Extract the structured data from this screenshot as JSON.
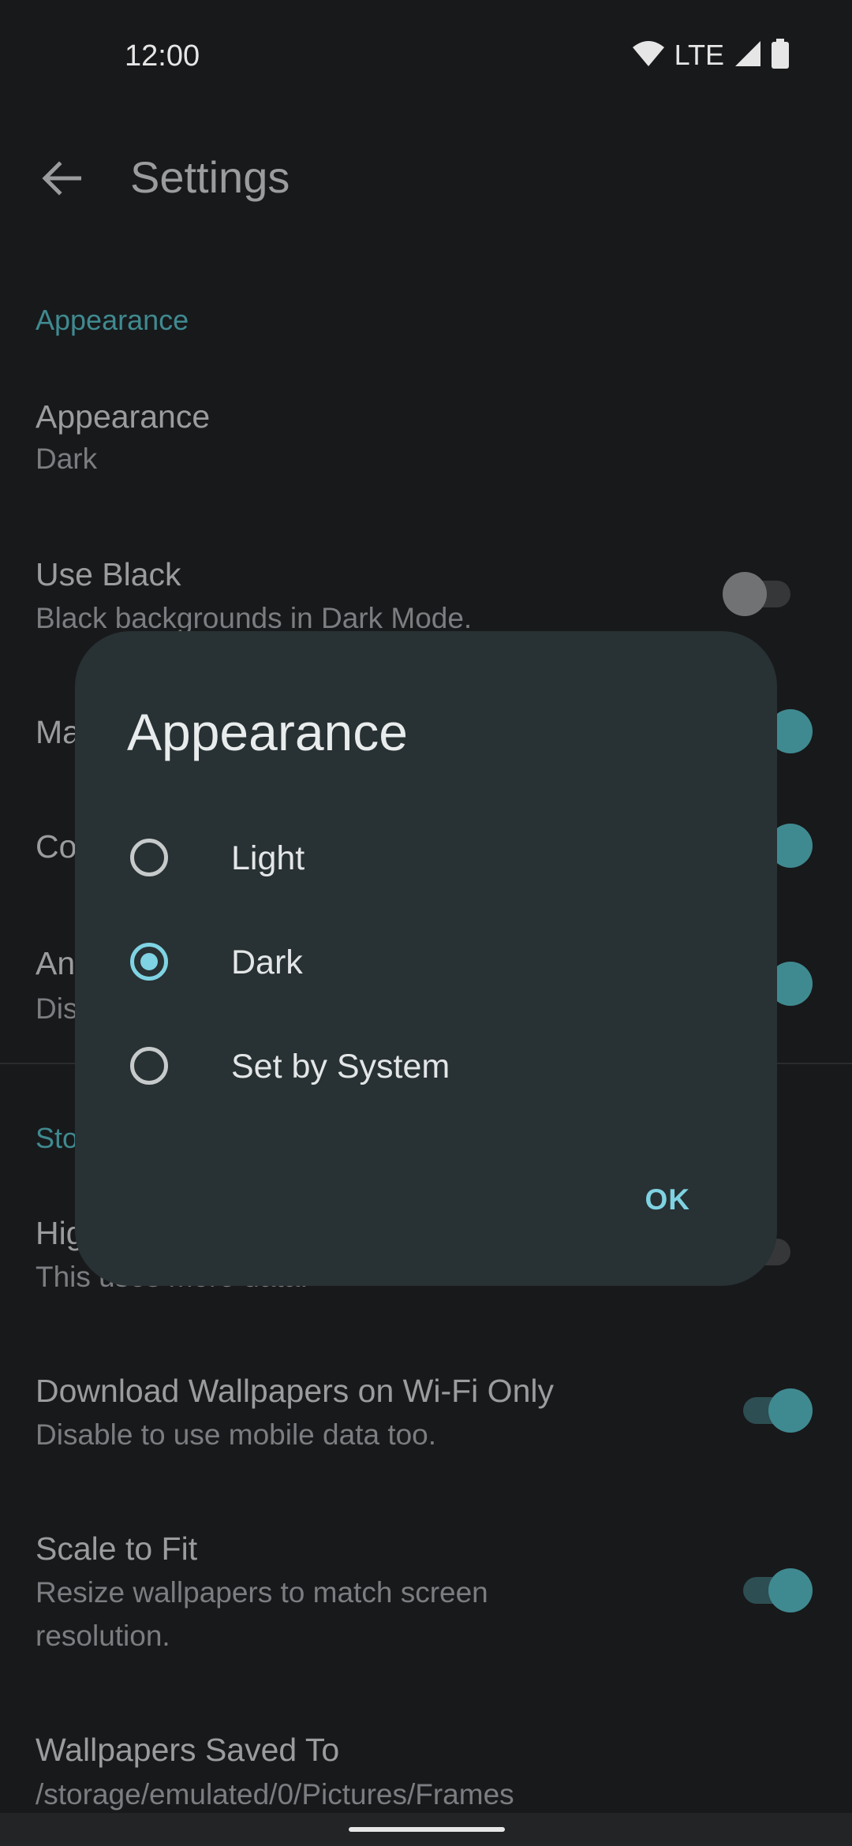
{
  "status_bar": {
    "time": "12:00",
    "network": "LTE",
    "icons": [
      "wifi-icon",
      "signal-icon",
      "battery-icon"
    ]
  },
  "app_bar": {
    "title": "Settings",
    "back_icon": "arrow-back-icon"
  },
  "sections": {
    "appearance_header": "Appearance",
    "storage_header": "Sto"
  },
  "prefs": {
    "appearance": {
      "title": "Appearance",
      "summary": "Dark"
    },
    "use_black": {
      "title": "Use Black",
      "summary": "Black backgrounds in Dark Mode.",
      "enabled": false
    },
    "row3": {
      "title": "Ma",
      "enabled": true
    },
    "row4": {
      "title": "Co",
      "enabled": true
    },
    "row5": {
      "title": "An",
      "summary": "Dis",
      "enabled": true
    },
    "high_quality": {
      "title": "Hig",
      "summary": "This uses more data.",
      "enabled": false
    },
    "wifi_only": {
      "title": "Download Wallpapers on Wi-Fi Only",
      "summary": "Disable to use mobile data too.",
      "enabled": true
    },
    "scale_to_fit": {
      "title": "Scale to Fit",
      "summary_line1": "Resize wallpapers to match screen",
      "summary_line2": "resolution.",
      "enabled": true
    },
    "saved_to": {
      "title": "Wallpapers Saved To",
      "summary": "/storage/emulated/0/Pictures/Frames"
    }
  },
  "dialog": {
    "title": "Appearance",
    "options": [
      {
        "label": "Light",
        "selected": false
      },
      {
        "label": "Dark",
        "selected": true
      },
      {
        "label": "Set by System",
        "selected": false
      }
    ],
    "ok_label": "OK"
  },
  "colors": {
    "accent": "#7fd3e3",
    "background": "#18191b",
    "dialog": "#283133"
  }
}
